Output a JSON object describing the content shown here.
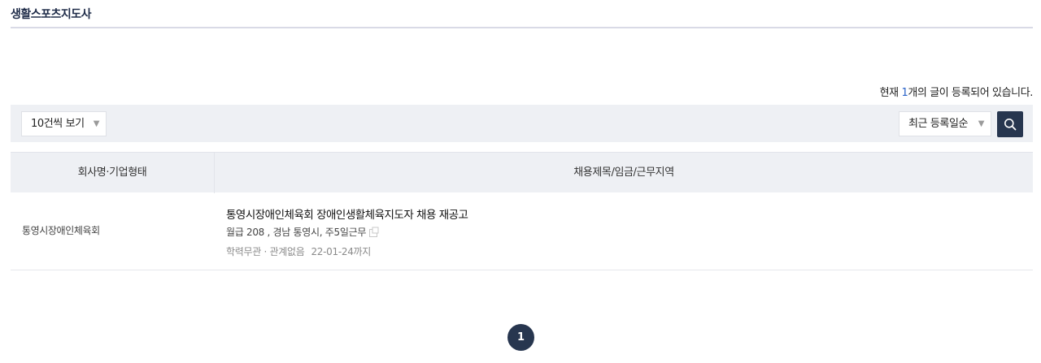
{
  "page": {
    "title": "생활스포츠지도사"
  },
  "count_line": {
    "prefix": "현재 ",
    "count": "1",
    "suffix": "개의 글이 등록되어 있습니다."
  },
  "toolbar": {
    "per_page_label": "10건씩 보기",
    "sort_label": "최근 등록일순",
    "arrow_glyph": "▼"
  },
  "table": {
    "headers": {
      "company": "회사명·기업형태",
      "job": "채용제목/임금/근무지역"
    },
    "rows": [
      {
        "company": "통영시장애인체육회",
        "title": "통영시장애인체육회 장애인생활체육지도자 채용 재공고",
        "meta": "월급 208 , 경남 통영시, 주5일근무",
        "sub": "학력무관 · 관계없음",
        "deadline": "22-01-24까지"
      }
    ]
  },
  "pagination": {
    "current": "1"
  },
  "colors": {
    "accent_navy": "#27364f",
    "count_blue": "#2a63c9",
    "toolbar_bg": "#eef0f4"
  },
  "icons": {
    "search": "search-icon",
    "document": "document-icon"
  }
}
